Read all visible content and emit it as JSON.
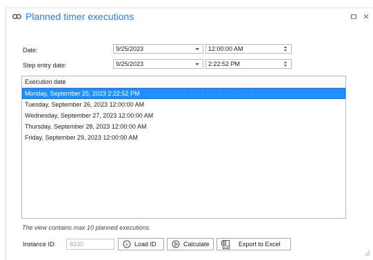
{
  "dialog": {
    "title": "Planned timer executions"
  },
  "form": {
    "date_label": "Date:",
    "date_value": "9/25/2023",
    "date_time_value": "12:00:00 AM",
    "step_label": "Step entry date:",
    "step_date_value": "9/25/2023",
    "step_time_value": "2:22:52 PM"
  },
  "grid": {
    "header": "Execution date",
    "rows": [
      "Monday, September 25, 2023 2:22:52 PM",
      "Tuesday, September 26, 2023 12:00:00 AM",
      "Wednesday, September 27, 2023 12:00:00 AM",
      "Thursday, September 28, 2023 12:00:00 AM",
      "Friday, September 29, 2023 12:00:00 AM"
    ],
    "selected_index": 0
  },
  "footer": {
    "note": "The view contains max 10 planned executions.",
    "instance_label": "Instance ID:",
    "instance_value": "8330",
    "load_label": "Load ID",
    "calculate_label": "Calculate",
    "export_label": "Export to Excel"
  },
  "colors": {
    "title": "#2b7cd3",
    "selection": "#1e90ff"
  }
}
